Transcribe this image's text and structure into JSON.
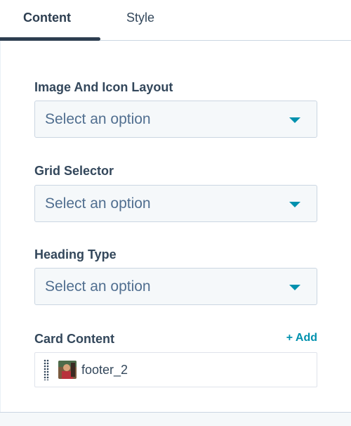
{
  "tabs": [
    {
      "label": "Content",
      "active": true
    },
    {
      "label": "Style",
      "active": false
    }
  ],
  "fields": {
    "image_icon_layout": {
      "label": "Image And Icon Layout",
      "placeholder": "Select an option"
    },
    "grid_selector": {
      "label": "Grid Selector",
      "placeholder": "Select an option"
    },
    "heading_type": {
      "label": "Heading Type",
      "placeholder": "Select an option"
    }
  },
  "card_content": {
    "label": "Card Content",
    "add_label": "+ Add",
    "items": [
      {
        "name": "footer_2",
        "icon": "image-thumbnail-icon"
      }
    ]
  },
  "colors": {
    "accent": "#0091ae",
    "text": "#33475b",
    "tab_indicator": "#2d3e50",
    "select_bg": "#f5f8fa",
    "border": "#cbd6e2"
  }
}
